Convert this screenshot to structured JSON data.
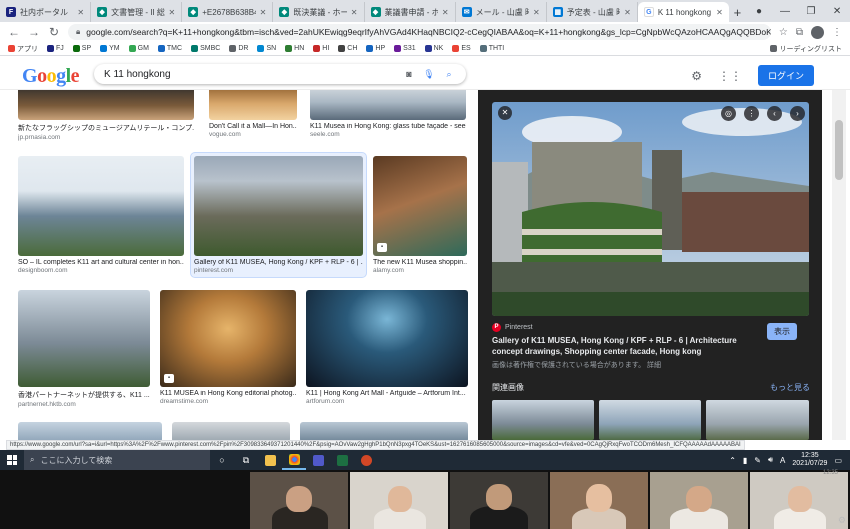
{
  "browser": {
    "tabs": [
      {
        "label": "社内ポータル",
        "icon": "portal-icon",
        "color": "#1a237e",
        "active": false
      },
      {
        "label": "文書管理 - II 総務",
        "icon": "doc-icon",
        "color": "#00897b",
        "active": false
      },
      {
        "label": "+E2678B638B4B",
        "icon": "doc-icon",
        "color": "#00897b",
        "active": false
      },
      {
        "label": "既決業議 - ホーム",
        "icon": "doc-icon",
        "color": "#00897b",
        "active": false
      },
      {
        "label": "業議書申請 - ホーム",
        "icon": "doc-icon",
        "color": "#00897b",
        "active": false
      },
      {
        "label": "メール - 山盧 時雨",
        "icon": "mail-icon",
        "color": "#0078d4",
        "active": false
      },
      {
        "label": "予定表 - 山盧 時雨",
        "icon": "calendar-icon",
        "color": "#0078d4",
        "active": false
      },
      {
        "label": "K 11 hongkong",
        "icon": "google-icon",
        "color": "#4285f4",
        "active": true
      }
    ],
    "new_tab": "+",
    "url": "google.com/search?q=K+11+hongkong&tbm=isch&ved=2ahUKEwiqg9eqrIfyAhVGAd4KHaqNBCIQ2-cCegQIABAA&oq=K+11+hongkong&gs_lcp=CgNpbWcQAzoHCAAQgAQQBDoKCAAQgAQQsQMQBD...",
    "bookmarks": [
      {
        "label": "アプリ",
        "color": "#ea4335"
      },
      {
        "label": "FJ",
        "color": "#1a237e"
      },
      {
        "label": "SP",
        "color": "#0b6a0b"
      },
      {
        "label": "YM",
        "color": "#0078d4"
      },
      {
        "label": "GM",
        "color": "#34a853"
      },
      {
        "label": "TMC",
        "color": "#1565c0"
      },
      {
        "label": "SMBC",
        "color": "#00796b"
      },
      {
        "label": "DR",
        "color": "#5f6368"
      },
      {
        "label": "SN",
        "color": "#0288d1"
      },
      {
        "label": "HN",
        "color": "#2e7d32"
      },
      {
        "label": "HI",
        "color": "#c62828"
      },
      {
        "label": "CH",
        "color": "#424242"
      },
      {
        "label": "HP",
        "color": "#1565c0"
      },
      {
        "label": "S31",
        "color": "#6a1b9a"
      },
      {
        "label": "NK",
        "color": "#283593"
      },
      {
        "label": "ES",
        "color": "#ea4335"
      },
      {
        "label": "THTI",
        "color": "#546e7a"
      }
    ],
    "reading_list": "リーディングリスト"
  },
  "google": {
    "logo_letters": [
      "G",
      "o",
      "o",
      "g",
      "l",
      "e"
    ],
    "query": "K 11 hongkong",
    "login_label": "ログイン"
  },
  "results": [
    {
      "caption": "新たなフラッグシップのミュージアムリテール・コンプ...",
      "source": "jp.prnasia.com",
      "colors": [
        "#2b2b2b",
        "#7a5a3a",
        "#c9a27a"
      ]
    },
    {
      "caption": "Don't Call it a Mall—In Hon...",
      "source": "vogue.com",
      "colors": [
        "#8a5a2a",
        "#d9a86c",
        "#f2d2a0"
      ]
    },
    {
      "caption": "K11 Musea in Hong Kong: glass tube façade - seele",
      "source": "seele.com",
      "colors": [
        "#aab8c4",
        "#5a6a7a",
        "#d8dde2"
      ]
    },
    {
      "caption": "SO – IL completes K11 art and cultural center in hon...",
      "source": "designboom.com",
      "colors": [
        "#dfe7ee",
        "#6d8597",
        "#4b6b3a"
      ]
    },
    {
      "caption": "Gallery of K11 MUSEA, Hong Kong / KPF + RLP - 6 | ...",
      "source": "pinterest.com",
      "colors": [
        "#9aa8b8",
        "#6b6b5b",
        "#3e5a2e"
      ]
    },
    {
      "caption": "The new K11 Musea shoppin...",
      "source": "alamy.com",
      "colors": [
        "#5a3a22",
        "#a6724a",
        "#2e6a5a"
      ]
    },
    {
      "caption": "香港パートナーネットが提供する、K11 ...",
      "source": "partnernet.hktb.com",
      "colors": [
        "#c9d4de",
        "#7c8a96",
        "#3f5c34"
      ]
    },
    {
      "caption": "K11 MUSEA in Hong Kong editorial photog...",
      "source": "dreamstime.com",
      "colors": [
        "#3a2a1a",
        "#b47a3a",
        "#e6b46a"
      ]
    },
    {
      "caption": "K11 | Hong Kong Art Mall - Artguide – Artforum Int...",
      "source": "artforum.com",
      "colors": [
        "#0d1420",
        "#2a5a7a",
        "#7ab6d6"
      ]
    }
  ],
  "preview": {
    "source_name": "Pinterest",
    "visit_label": "表示",
    "title": "Gallery of K11 MUSEA, Hong Kong / KPF + RLP - 6 | Architecture concept drawings, Shopping center facade, Hong kong",
    "copyright_note": "画像は著作権で保護されている場合があります。 詳細",
    "related_label": "関連画像",
    "more_label": "もっと見る"
  },
  "status_url": "https://www.google.com/url?sa=i&url=https%3A%2F%2Fwww.pinterest.com%2Fpin%2F309833649371201440%2F&psig=AOvVaw2gHghP1bQnN3pxg4TOeKS&ust=1627616085605000&source=images&cd=vfe&ved=0CAgQjRxqFwoTCODm6Mesh_ICFQAAAAAdAAAAABAI",
  "taskbar": {
    "search_placeholder": "ここに入力して検索",
    "time": "12:35",
    "date": "2021/07/29"
  },
  "meeting": {
    "time_label": "12:35"
  }
}
